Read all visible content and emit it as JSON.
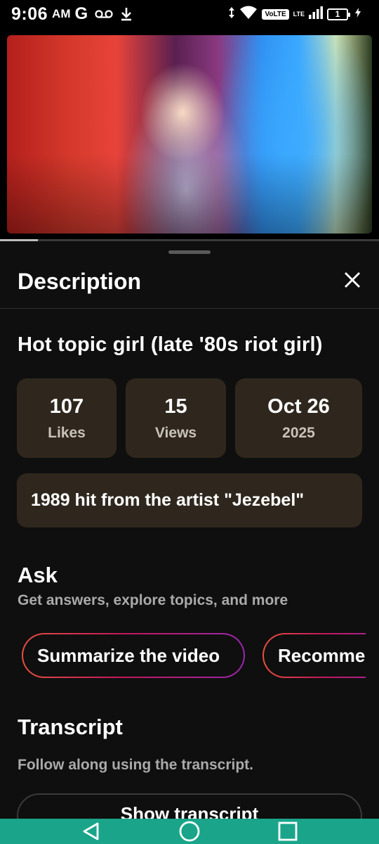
{
  "status_bar": {
    "time": "9:06",
    "ampm": "AM",
    "carrier_letter": "G",
    "volte": "VoLTE",
    "lte": "LTE",
    "battery": "1",
    "icons": [
      "voicemail-icon",
      "download-icon",
      "data-arrows-icon",
      "wifi-icon",
      "signal-icon",
      "charging-icon"
    ]
  },
  "video": {
    "progress": 0.1
  },
  "sheet": {
    "title": "Description",
    "close_icon": "close-icon"
  },
  "video_title": "Hot topic girl (late '80s riot girl)",
  "stats": [
    {
      "value": "107",
      "label": "Likes"
    },
    {
      "value": "15",
      "label": "Views"
    },
    {
      "value": "Oct 26",
      "label": "2025"
    }
  ],
  "description": "1989 hit from the artist \"Jezebel\"",
  "ask": {
    "title": "Ask",
    "subtitle": "Get answers, explore topics, and more",
    "chips": [
      "Summarize the video",
      "Recommend"
    ]
  },
  "transcript": {
    "title": "Transcript",
    "subtitle": "Follow along using the transcript.",
    "button": "Show transcript"
  },
  "nav_bar": {
    "icons": [
      "back-icon",
      "home-icon",
      "recents-icon"
    ],
    "color": "#1aa58a"
  },
  "colors": {
    "card_bg": "#2f271d",
    "chip_gradient": [
      "#e8503f",
      "#c2185b",
      "#9c27b0"
    ]
  }
}
